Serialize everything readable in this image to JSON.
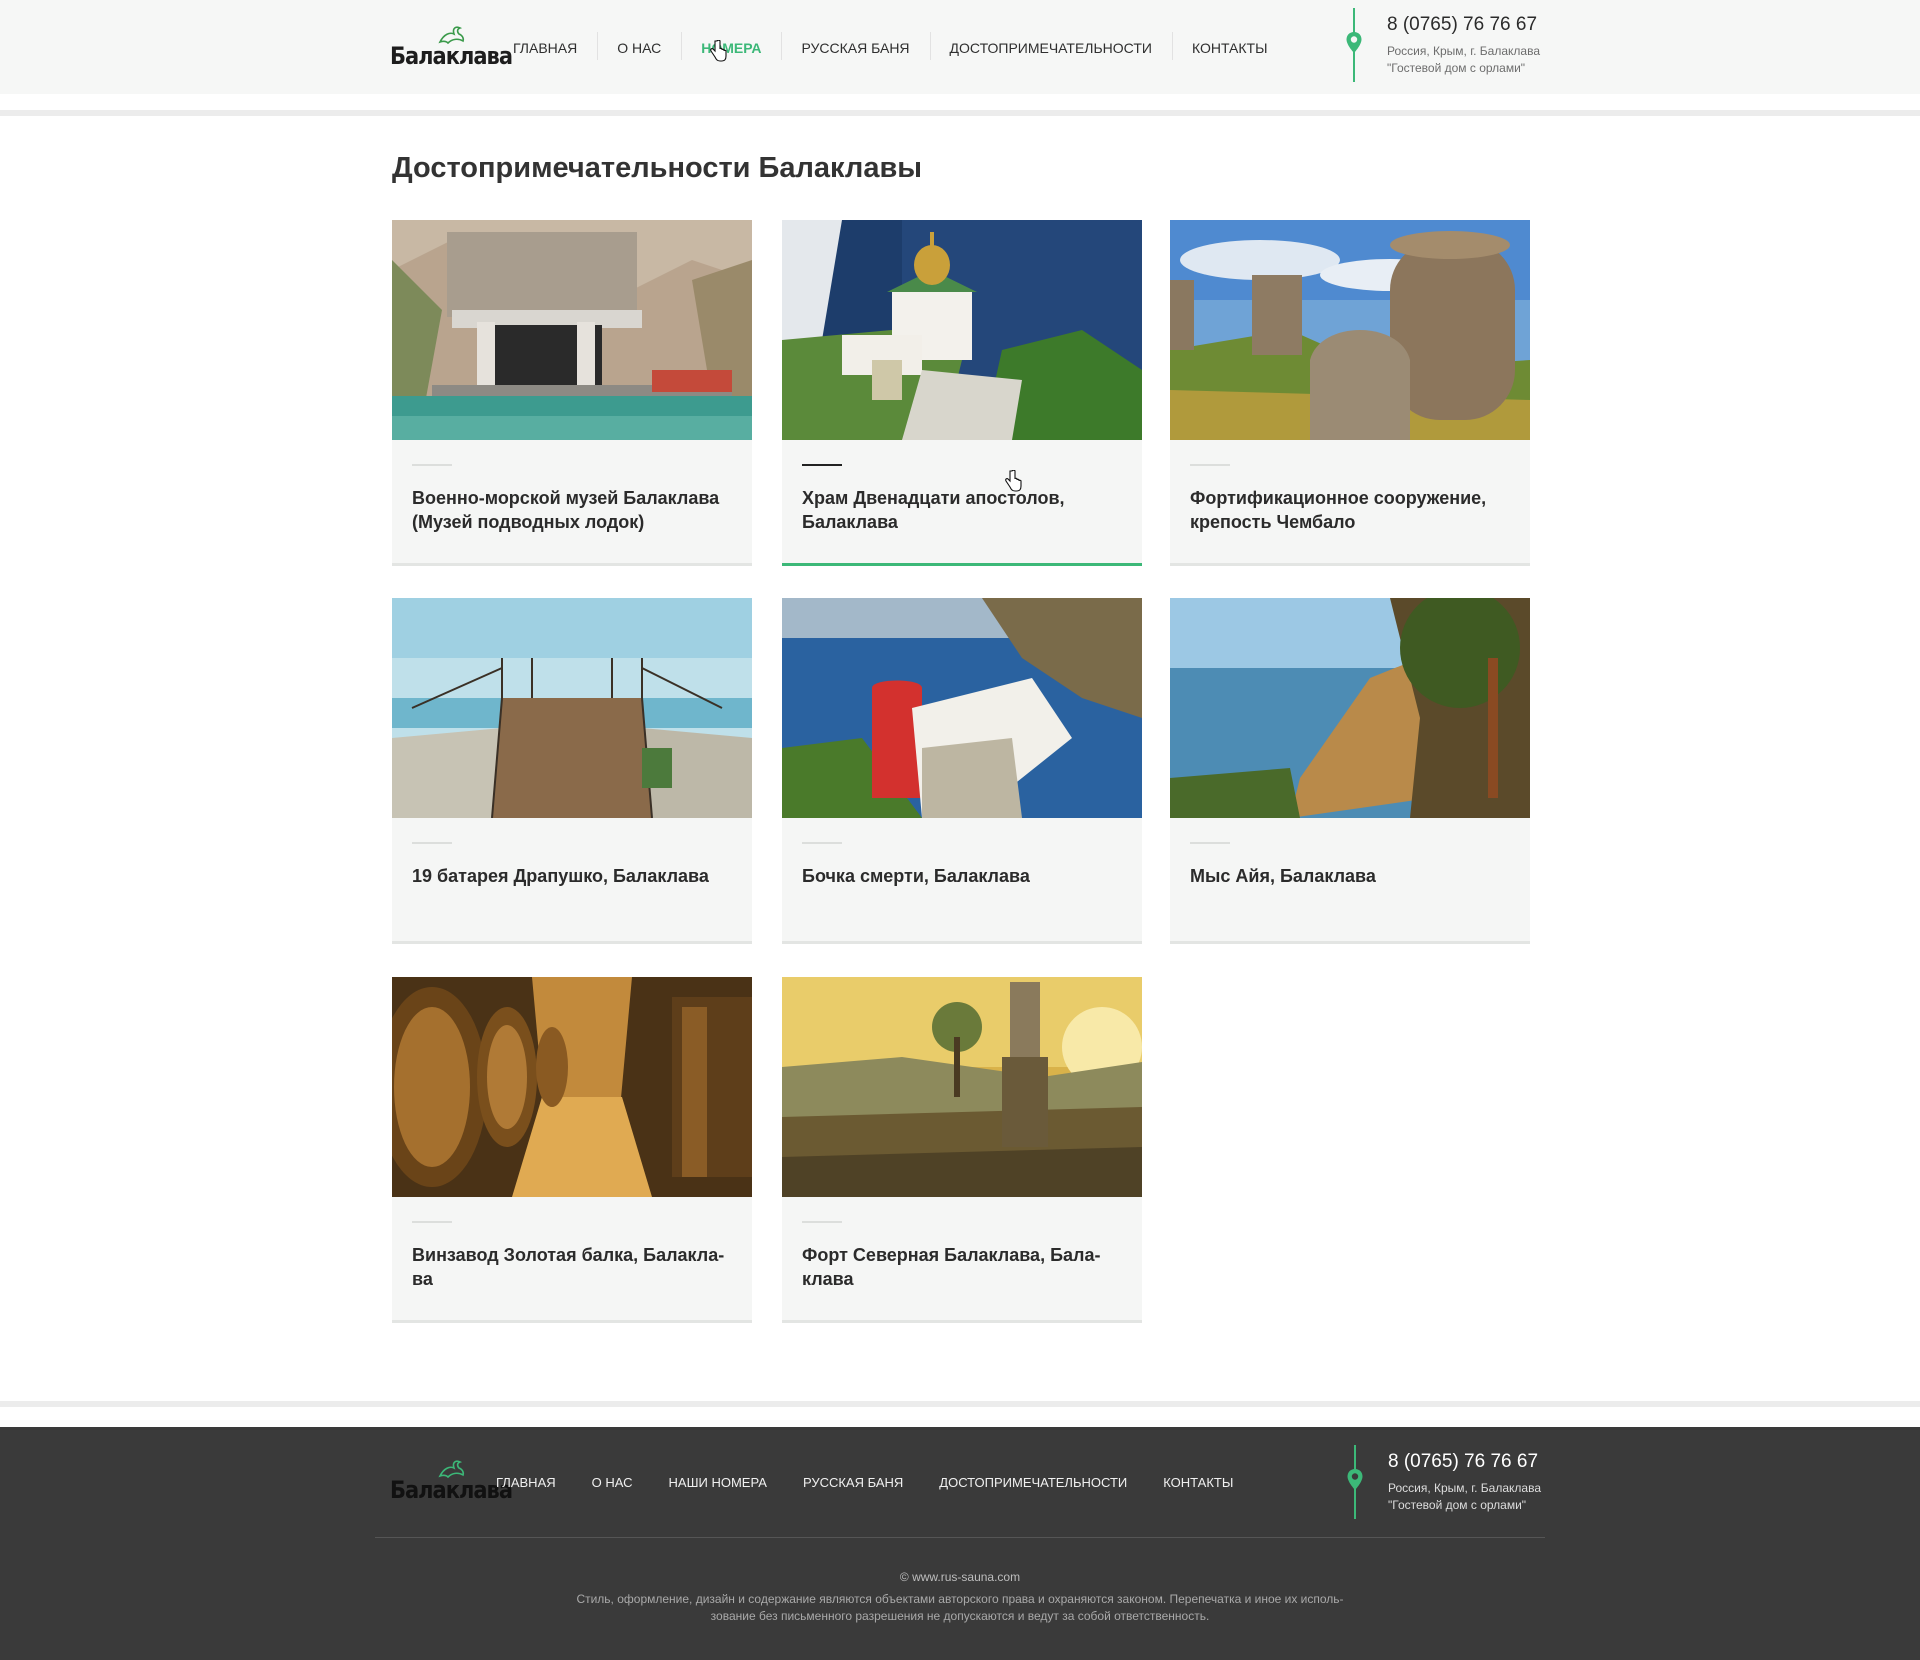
{
  "brand": {
    "logo_text": "Балаклава"
  },
  "nav": {
    "items": [
      {
        "label": "Главная"
      },
      {
        "label": "О нас"
      },
      {
        "label": "Номера"
      },
      {
        "label": "Русская баня"
      },
      {
        "label": "Достопримечательности"
      },
      {
        "label": "Контакты"
      }
    ]
  },
  "contact": {
    "phone": "8 (0765) 76 76 67",
    "address_line1": "Россия, Крым, г. Балаклава",
    "address_line2": "\"Гостевой дом с орлами\""
  },
  "main": {
    "title": "Достопримечательности Балаклавы",
    "cards": [
      {
        "title": "Военно-морской музей Балаклава (Музей подводных лодок)",
        "photo": "submarine-museum-photo"
      },
      {
        "title": "Храм Двенадцати апостолов, Балаклава",
        "photo": "church-photo"
      },
      {
        "title": "Фортификационное сооружение, крепость Чембало",
        "photo": "fortress-photo"
      },
      {
        "title": "19 батарея Драпушко, Балаклава",
        "photo": "battery-photo"
      },
      {
        "title": "Бочка смерти, Балаклава",
        "photo": "barrel-of-death-photo"
      },
      {
        "title": "Мыс Айя, Балаклава",
        "photo": "cape-aiya-photo"
      },
      {
        "title": "Винзавод Золотая балка, Балакла-ва",
        "photo": "winery-photo"
      },
      {
        "title": "Форт Северная Балаклава, Бала-клава",
        "photo": "fort-photo"
      }
    ]
  },
  "footer": {
    "nav": [
      {
        "label": "Главная"
      },
      {
        "label": "О нас"
      },
      {
        "label": "Наши номера"
      },
      {
        "label": "Русская баня"
      },
      {
        "label": "Достопримечательности"
      },
      {
        "label": "Контакты"
      }
    ],
    "copyright": "©  www.rus-sauna.com",
    "legal": "Стиль, оформление, дизайн и содержание являются объектами авторского права и охраняются законом. Перепечатка и иное их исполь-зование без письменного разрешения не допускаются и ведут за собой ответственность."
  },
  "colors": {
    "accent": "#3cb878",
    "footer_bg": "#3a3a3a",
    "card_bg": "#f5f6f5"
  }
}
